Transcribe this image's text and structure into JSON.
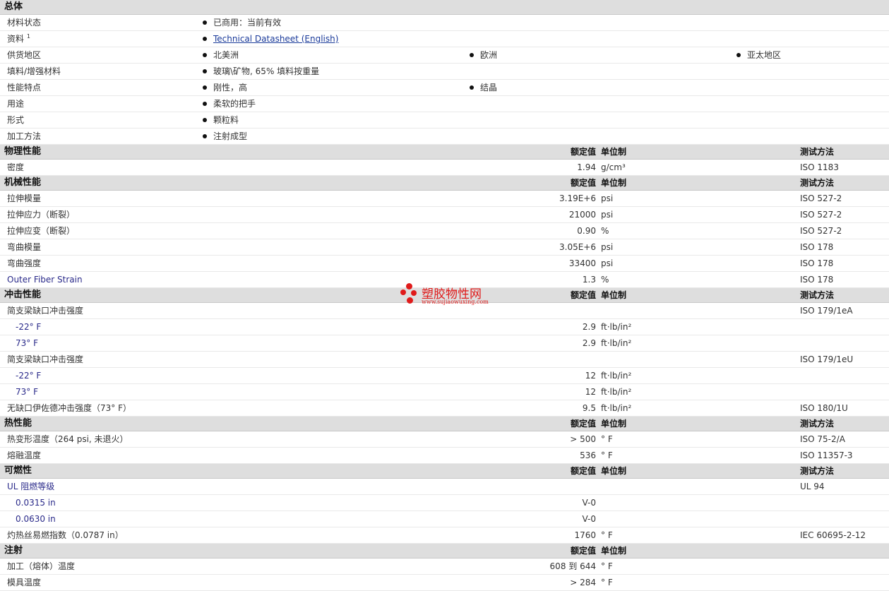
{
  "sections": {
    "general": {
      "title": "总体",
      "rows": [
        {
          "label": "材料状态",
          "values": [
            "已商用：当前有效"
          ]
        },
        {
          "label": "资料",
          "sup": "1",
          "values": [
            "Technical Datasheet (English)"
          ]
        },
        {
          "label": "供货地区",
          "values": [
            "北美洲",
            "欧洲",
            "亚太地区"
          ]
        },
        {
          "label": "填料/增强材料",
          "values": [
            "玻璃\\矿物, 65% 填料按重量"
          ]
        },
        {
          "label": "性能特点",
          "values": [
            "刚性，高",
            "结晶"
          ]
        },
        {
          "label": "用途",
          "values": [
            "柔软的把手"
          ]
        },
        {
          "label": "形式",
          "values": [
            "颗粒料"
          ]
        },
        {
          "label": "加工方法",
          "values": [
            "注射成型"
          ]
        }
      ]
    },
    "physical": {
      "title": "物理性能",
      "col_value": "额定值",
      "col_unit": "单位制",
      "col_test": "测试方法",
      "rows": [
        {
          "label": "密度",
          "value": "1.94",
          "unit": "g/cm³",
          "test": "ISO 1183"
        }
      ]
    },
    "mechanical": {
      "title": "机械性能",
      "col_value": "额定值",
      "col_unit": "单位制",
      "col_test": "测试方法",
      "rows": [
        {
          "label": "拉伸模量",
          "value": "3.19E+6",
          "unit": "psi",
          "test": "ISO 527-2"
        },
        {
          "label": "拉伸应力（断裂）",
          "value": "21000",
          "unit": "psi",
          "test": "ISO 527-2"
        },
        {
          "label": "拉伸应变（断裂）",
          "value": "0.90",
          "unit": "%",
          "test": "ISO 527-2"
        },
        {
          "label": "弯曲模量",
          "value": "3.05E+6",
          "unit": "psi",
          "test": "ISO 178"
        },
        {
          "label": "弯曲强度",
          "value": "33400",
          "unit": "psi",
          "test": "ISO 178"
        },
        {
          "label": "Outer Fiber Strain",
          "value": "1.3",
          "unit": "%",
          "test": "ISO 178"
        }
      ]
    },
    "impact": {
      "title": "冲击性能",
      "col_value": "额定值",
      "col_unit": "单位制",
      "col_test": "测试方法",
      "rows": [
        {
          "label": "简支梁缺口冲击强度",
          "value": "",
          "unit": "",
          "test": "ISO 179/1eA"
        },
        {
          "label": "-22° F",
          "sub": true,
          "value": "2.9",
          "unit": "ft·lb/in²",
          "test": ""
        },
        {
          "label": "73° F",
          "sub": true,
          "value": "2.9",
          "unit": "ft·lb/in²",
          "test": ""
        },
        {
          "label": "简支梁缺口冲击强度",
          "value": "",
          "unit": "",
          "test": "ISO 179/1eU"
        },
        {
          "label": "-22° F",
          "sub": true,
          "value": "12",
          "unit": "ft·lb/in²",
          "test": ""
        },
        {
          "label": "73° F",
          "sub": true,
          "value": "12",
          "unit": "ft·lb/in²",
          "test": ""
        },
        {
          "label": "无缺口伊佐德冲击强度（73° F）",
          "value": "9.5",
          "unit": "ft·lb/in²",
          "test": "ISO 180/1U"
        }
      ]
    },
    "thermal": {
      "title": "热性能",
      "col_value": "额定值",
      "col_unit": "单位制",
      "col_test": "测试方法",
      "rows": [
        {
          "label": "热变形温度（264 psi, 未退火）",
          "value": "> 500",
          "unit": "° F",
          "test": "ISO 75-2/A"
        },
        {
          "label": "熔融温度",
          "value": "536",
          "unit": "° F",
          "test": "ISO 11357-3"
        }
      ]
    },
    "flammability": {
      "title": "可燃性",
      "col_value": "额定值",
      "col_unit": "单位制",
      "col_test": "测试方法",
      "rows": [
        {
          "label": "UL 阻燃等级",
          "value": "",
          "unit": "",
          "test": "UL 94"
        },
        {
          "label": "0.0315 in",
          "sub": true,
          "value": "V-0",
          "unit": "",
          "test": ""
        },
        {
          "label": "0.0630 in",
          "sub": true,
          "value": "V-0",
          "unit": "",
          "test": ""
        },
        {
          "label": "灼热丝易燃指数（0.0787 in）",
          "value": "1760",
          "unit": "° F",
          "test": "IEC 60695-2-12"
        }
      ]
    },
    "injection": {
      "title": "注射",
      "col_value": "额定值",
      "col_unit": "单位制",
      "rows": [
        {
          "label": "加工（熔体）温度",
          "value": "608 到 644",
          "unit": "° F",
          "test": ""
        },
        {
          "label": "模具温度",
          "value": "> 284",
          "unit": "° F",
          "test": ""
        }
      ]
    }
  },
  "watermark": {
    "text": "塑胶物性网",
    "url": "www.sujiaowuxing.com",
    "color": "#e01b1b"
  }
}
